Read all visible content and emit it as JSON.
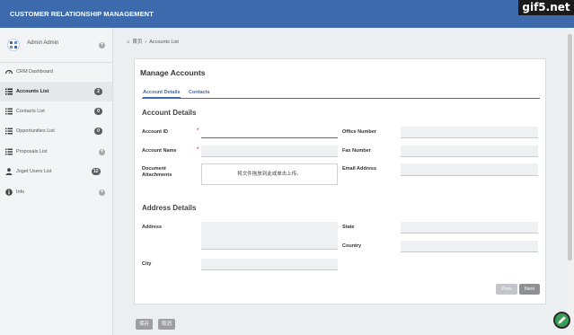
{
  "app": {
    "title": "CUSTOMER RELATIONSHIP MANAGEMENT"
  },
  "watermark": "gif5.net",
  "user": {
    "name": "Admin Admin",
    "avatar_icon": "user-avatar-icon"
  },
  "sidebar": {
    "items": [
      {
        "label": "CRM Dashboard",
        "icon": "dashboard-icon",
        "badge": null,
        "plus": false,
        "active": false
      },
      {
        "label": "Accounts List",
        "icon": "list-icon",
        "badge": "2",
        "plus": false,
        "active": true
      },
      {
        "label": "Contacts List",
        "icon": "list-icon",
        "badge": "0",
        "plus": false,
        "active": false
      },
      {
        "label": "Opportunities List",
        "icon": "list-icon",
        "badge": "0",
        "plus": false,
        "active": false
      },
      {
        "label": "Proposals List",
        "icon": "list-icon",
        "badge": null,
        "plus": true,
        "active": false
      },
      {
        "label": "Joget Users List",
        "icon": "user-icon",
        "badge": "12",
        "plus": false,
        "active": false
      },
      {
        "label": "Info",
        "icon": "info-icon",
        "badge": null,
        "plus": true,
        "active": false
      }
    ]
  },
  "breadcrumb": {
    "home": "首页",
    "separator": "›",
    "current": "Accounts List"
  },
  "form": {
    "title": "Manage Accounts",
    "tabs": [
      "Account Details",
      "Contacts"
    ],
    "account_section": "Account Details",
    "fields": {
      "account_id": {
        "label": "Account ID",
        "value": ""
      },
      "account_name": {
        "label": "Account Name",
        "value": ""
      },
      "document_attachments": {
        "label": "Document Attachments",
        "dropzone": "将文件拖放到此或单击上传。"
      },
      "office_number": {
        "label": "Office Number",
        "value": ""
      },
      "fax_number": {
        "label": "Fax Number",
        "value": ""
      },
      "email_address": {
        "label": "Email Address",
        "value": ""
      }
    },
    "address_section": "Address Details",
    "address_fields": {
      "address": {
        "label": "Address",
        "value": ""
      },
      "city": {
        "label": "City",
        "value": ""
      },
      "state": {
        "label": "State",
        "value": ""
      },
      "country": {
        "label": "Country",
        "value": ""
      }
    },
    "required_mark": "*",
    "prev_label": "Prev",
    "next_label": "Next"
  },
  "actions": {
    "save": "保存",
    "cancel": "取消"
  },
  "colors": {
    "header": "#3d69ad",
    "accent": "#3d69ad",
    "fab": "#3a9d57"
  }
}
